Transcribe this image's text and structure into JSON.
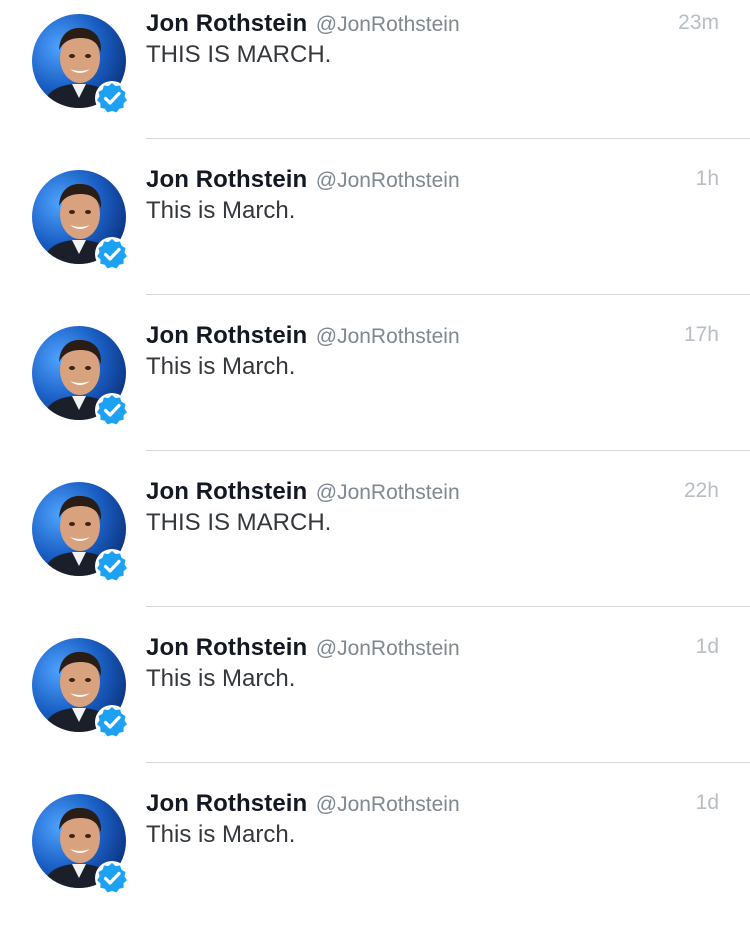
{
  "timeline": {
    "tweets": [
      {
        "name": "Jon Rothstein",
        "handle": "@JonRothstein",
        "time": "23m",
        "text": "THIS IS MARCH.",
        "verified": true
      },
      {
        "name": "Jon Rothstein",
        "handle": "@JonRothstein",
        "time": "1h",
        "text": "This is March.",
        "verified": true
      },
      {
        "name": "Jon Rothstein",
        "handle": "@JonRothstein",
        "time": "17h",
        "text": "This is March.",
        "verified": true
      },
      {
        "name": "Jon Rothstein",
        "handle": "@JonRothstein",
        "time": "22h",
        "text": "THIS IS MARCH.",
        "verified": true
      },
      {
        "name": "Jon Rothstein",
        "handle": "@JonRothstein",
        "time": "1d",
        "text": "This is March.",
        "verified": true
      },
      {
        "name": "Jon Rothstein",
        "handle": "@JonRothstein",
        "time": "1d",
        "text": "This is March.",
        "verified": true
      }
    ]
  },
  "colors": {
    "name": "#141823",
    "handle": "#7f8790",
    "time": "#b8bec4",
    "text": "#34373c",
    "divider": "#d6d9dc",
    "verified_badge": "#1da1f2",
    "avatar_background": "#1a5fc4"
  },
  "icons": {
    "avatar": "profile-photo",
    "verified": "verified-checkmark-badge"
  }
}
